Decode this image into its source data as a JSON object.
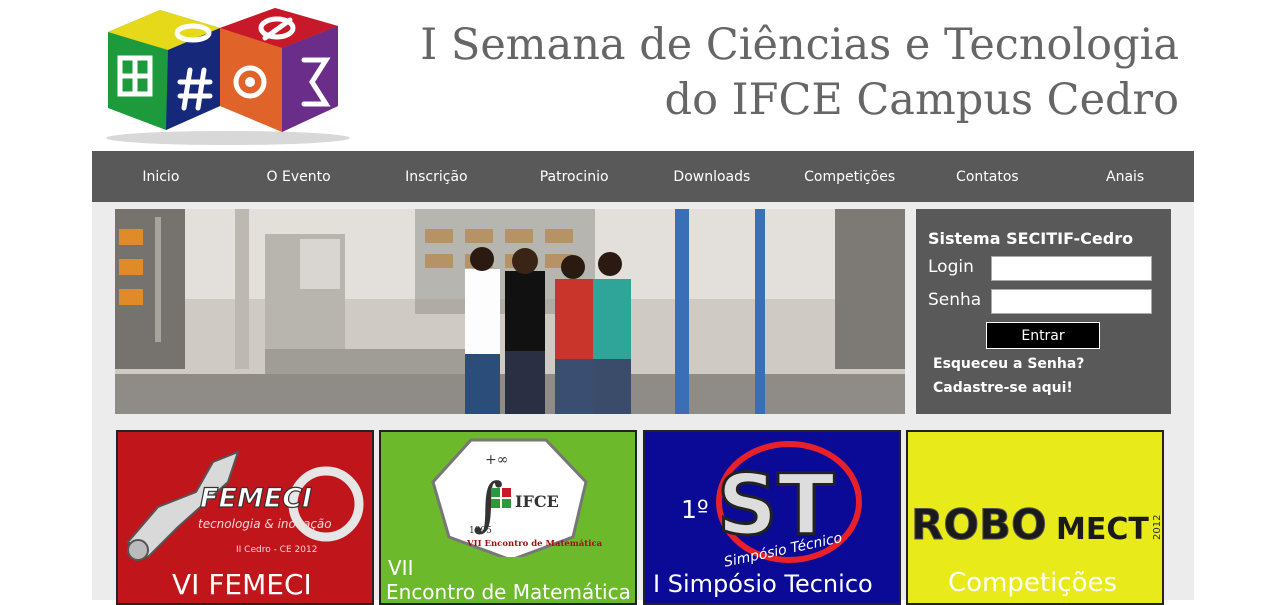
{
  "header": {
    "title_line1": "I Semana de Ciências e Tecnologia",
    "title_line2": "do IFCE Campus Cedro"
  },
  "nav": {
    "items": [
      "Inicio",
      "O Evento",
      "Inscrição",
      "Patrocinio",
      "Downloads",
      "Competições",
      "Contatos",
      "Anais"
    ]
  },
  "login": {
    "title": "Sistema SECITIF-Cedro",
    "login_label": "Login",
    "password_label": "Senha",
    "login_value": "",
    "password_value": "",
    "submit_label": "Entrar",
    "forgot_link": "Esqueceu a Senha?",
    "signup_link": "Cadastre-se aqui!"
  },
  "cards": [
    {
      "logo_text": "FEMECI",
      "logo_sub": "tecnologia & inovação",
      "logo_foot": "II Cedro - CE 2012",
      "label": "VI FEMECI",
      "bg": "#c0151a"
    },
    {
      "logo_text": "IFCE",
      "logo_year": "1995",
      "logo_sub": "VII Encontro de Matemática",
      "label_line1": "VII",
      "label_line2": "Encontro de Matemática",
      "bg": "#6cba2c"
    },
    {
      "logo_num": "1º",
      "logo_text": "ST",
      "logo_sub": "Simpósio Técnico",
      "label": "I Simpósio Tecnico",
      "bg": "#0a0a96"
    },
    {
      "logo_text": "ROBO",
      "logo_text2": "MECT",
      "logo_year": "2012",
      "label": "Competições",
      "bg": "#e8ea1a"
    }
  ],
  "colors": {
    "nav_bg": "#595959",
    "content_bg": "#ececec",
    "title_text": "#666666"
  }
}
